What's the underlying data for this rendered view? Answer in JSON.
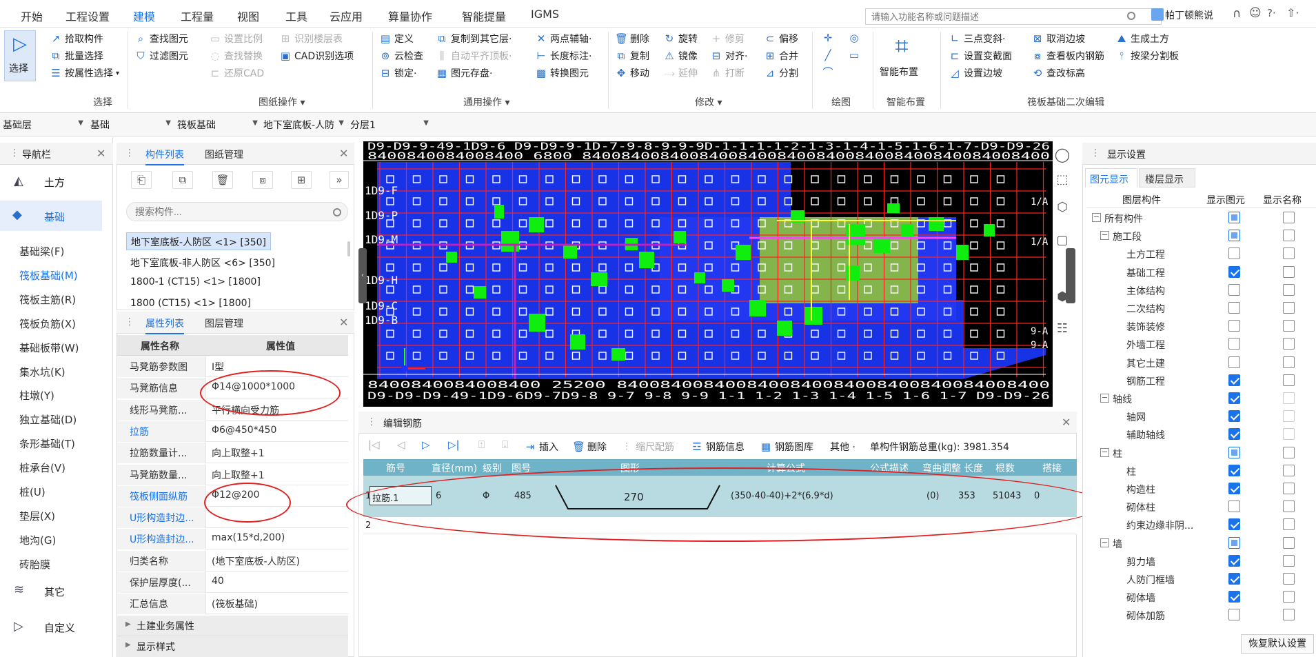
{
  "menu": {
    "items": [
      "开始",
      "工程设置",
      "建模",
      "工程量",
      "视图",
      "工具",
      "云应用",
      "算量协作",
      "智能提量",
      "IGMS"
    ],
    "active_index": 2,
    "search_placeholder": "请输入功能名称或问题描述",
    "user_name": "帕丁顿熊说",
    "help_label": "?·"
  },
  "ribbon": {
    "select": {
      "label": "选择",
      "pick": "拾取构件",
      "batch": "批量选择",
      "by_attr": "按属性选择",
      "group": "选择"
    },
    "drawing": {
      "find": "查找图元",
      "filter": "过滤图元",
      "set_scale": "设置比例",
      "find_replace": "查找替换",
      "restore_cad": "还原CAD",
      "identify_floor": "识别楼层表",
      "cad_options": "CAD识别选项",
      "group": "图纸操作 ▾"
    },
    "common": {
      "define": "定义",
      "cloud_check": "云检查",
      "lock": "锁定·",
      "copy_to_floor": "复制到其它层·",
      "auto_flat": "自动平齐顶板·",
      "save_element": "图元存盘·",
      "two_point_axis": "两点辅轴·",
      "length_mark": "长度标注·",
      "convert": "转换图元",
      "group": "通用操作 ▾"
    },
    "modify": {
      "delete": "删除",
      "rotate": "旋转",
      "trim": "修剪",
      "offset": "偏移",
      "copy": "复制",
      "mirror": "镜像",
      "align": "对齐·",
      "merge": "合并",
      "move": "移动",
      "extend": "延伸",
      "break": "打断",
      "split": "分割",
      "group": "修改 ▾"
    },
    "draw": {
      "group": "绘图"
    },
    "smart": {
      "label": "智能布置",
      "group": "智能布置"
    },
    "raft": {
      "three_point_slope": "三点变斜·",
      "cancel_slope": "取消边坡",
      "gen_earth": "生成土方",
      "set_var_section": "设置变截面",
      "view_rebar": "查看板内钢筋",
      "split_by_beam": "按梁分割板",
      "set_slope": "设置边坡",
      "check_elev": "查改标高",
      "group": "筏板基础二次编辑"
    }
  },
  "floorbar": {
    "floor": "基础层",
    "category": "基础",
    "type": "筏板基础",
    "component": "地下室底板-人防",
    "layer": "分层1"
  },
  "nav": {
    "title": "导航栏",
    "groups": [
      {
        "label": "土方"
      },
      {
        "label": "基础"
      }
    ],
    "items": [
      "基础梁(F)",
      "筏板基础(M)",
      "筏板主筋(R)",
      "筏板负筋(X)",
      "基础板带(W)",
      "集水坑(K)",
      "柱墩(Y)",
      "独立基础(D)",
      "条形基础(T)",
      "桩承台(V)",
      "桩(U)",
      "垫层(X)",
      "地沟(G)",
      "砖胎膜"
    ],
    "selected_index": 1,
    "other": "其它",
    "custom": "自定义"
  },
  "component_list": {
    "tabs": [
      "构件列表",
      "图纸管理"
    ],
    "search_placeholder": "搜索构件...",
    "items": [
      "地下室底板-人防区 <1> [350]",
      "地下室底板-非人防区 <6> [350]",
      "1800-1 (CT15)  <1> [1800]",
      "1800  (CT15)  <1> [1800]"
    ],
    "selected_index": 0
  },
  "properties": {
    "tabs": [
      "属性列表",
      "图层管理"
    ],
    "header_name": "属性名称",
    "header_value": "属性值",
    "rows": [
      {
        "name": "马凳筋参数图",
        "value": "Ⅰ型",
        "blue": false
      },
      {
        "name": "马凳筋信息",
        "value": "Φ14@1000*1000",
        "blue": false
      },
      {
        "name": "线形马凳筋...",
        "value": "平行横向受力筋",
        "blue": false
      },
      {
        "name": "拉筋",
        "value": "Φ6@450*450",
        "blue": true
      },
      {
        "name": "拉筋数量计...",
        "value": "向上取整+1",
        "blue": false
      },
      {
        "name": "马凳筋数量...",
        "value": "向上取整+1",
        "blue": false
      },
      {
        "name": "筏板侧面纵筋",
        "value": "Φ12@200",
        "blue": true
      },
      {
        "name": "U形构造封边...",
        "value": "",
        "blue": true
      },
      {
        "name": "U形构造封边...",
        "value": "max(15*d,200)",
        "blue": true
      },
      {
        "name": "归类名称",
        "value": "(地下室底板-人防区)",
        "blue": false
      },
      {
        "name": "保护层厚度(...",
        "value": "40",
        "blue": false
      },
      {
        "name": "汇总信息",
        "value": "(筏板基础)",
        "blue": false
      }
    ],
    "sections": [
      "土建业务属性",
      "显示样式"
    ]
  },
  "canvas": {
    "top_labels": "D9-D9-9-49-1D9-6  D9-D9-9-1D-7-9-8-9-9-9D-1-1-1-1-2-1-3-1-4-1-5-1-6-1-7-D9-D9-26",
    "top_dims": "8400840084008400 6800 840084008400840084008400840084008400840084008400",
    "bottom_dims": "8400840084008400 25200  8400840084008400840084008400840084008400",
    "bottom_labels": "D9-D9-D9-49-1D9-6D9-7D9-8   9-7 9-8 9-9 1-1 1-2 1-3 1-4 1-5 1-6 1-7 D9-D9-26",
    "row_labels": [
      "1D9-F",
      "1D9-P",
      "1D9-M",
      "1D9-H",
      "1D9-C",
      "1D9-B"
    ],
    "right_labels": [
      "1/A",
      "1/A",
      "9-A",
      "9-A"
    ]
  },
  "rebar": {
    "title": "编辑钢筋",
    "toolbar": {
      "insert": "插入",
      "delete": "删除",
      "scale": "缩尺配筋",
      "info": "钢筋信息",
      "library": "钢筋图库",
      "other": "其他 ·",
      "total": "单构件钢筋总重(kg): 3981.354"
    },
    "columns": [
      "筋号",
      "直径(mm)",
      "级别",
      "图号",
      "图形",
      "计算公式",
      "公式描述",
      "弯曲调整",
      "长度",
      "根数",
      "搭接"
    ],
    "rows": [
      {
        "idx": "1",
        "name": "拉筋.1",
        "dia": "6",
        "grade": "Φ",
        "fig": "485",
        "shape_len": "270",
        "formula": "(350-40-40)+2*(6.9*d)",
        "desc": "",
        "bend": "(0)",
        "length": "353",
        "count": "51043",
        "lap": "0"
      },
      {
        "idx": "2",
        "name": "",
        "dia": "",
        "grade": "",
        "fig": "",
        "shape_len": "",
        "formula": "",
        "desc": "",
        "bend": "",
        "length": "",
        "count": "",
        "lap": ""
      }
    ]
  },
  "display": {
    "title": "显示设置",
    "tabs": [
      "图元显示",
      "楼层显示"
    ],
    "headers": [
      "图层构件",
      "显示图元",
      "显示名称"
    ],
    "rows": [
      {
        "label": "所有构件",
        "level": 0,
        "exp": "−",
        "show": "partial",
        "name": "off"
      },
      {
        "label": "施工段",
        "level": 1,
        "exp": "−",
        "show": "partial",
        "name": "off"
      },
      {
        "label": "土方工程",
        "level": 2,
        "exp": "",
        "show": "off",
        "name": "off"
      },
      {
        "label": "基础工程",
        "level": 2,
        "exp": "",
        "show": "on",
        "name": "off"
      },
      {
        "label": "主体结构",
        "level": 2,
        "exp": "",
        "show": "off",
        "name": "off"
      },
      {
        "label": "二次结构",
        "level": 2,
        "exp": "",
        "show": "off",
        "name": "off"
      },
      {
        "label": "装饰装修",
        "level": 2,
        "exp": "",
        "show": "off",
        "name": "off"
      },
      {
        "label": "外墙工程",
        "level": 2,
        "exp": "",
        "show": "off",
        "name": "off"
      },
      {
        "label": "其它土建",
        "level": 2,
        "exp": "",
        "show": "off",
        "name": "off"
      },
      {
        "label": "钢筋工程",
        "level": 2,
        "exp": "",
        "show": "on",
        "name": "off"
      },
      {
        "label": "轴线",
        "level": 1,
        "exp": "−",
        "show": "on",
        "name": "dim"
      },
      {
        "label": "轴网",
        "level": 2,
        "exp": "",
        "show": "on",
        "name": "dim"
      },
      {
        "label": "辅助轴线",
        "level": 2,
        "exp": "",
        "show": "on",
        "name": "dim"
      },
      {
        "label": "柱",
        "level": 1,
        "exp": "−",
        "show": "partial",
        "name": "off"
      },
      {
        "label": "柱",
        "level": 2,
        "exp": "",
        "show": "on",
        "name": "off"
      },
      {
        "label": "构造柱",
        "level": 2,
        "exp": "",
        "show": "on",
        "name": "off"
      },
      {
        "label": "砌体柱",
        "level": 2,
        "exp": "",
        "show": "off",
        "name": "off"
      },
      {
        "label": "约束边缘非阴...",
        "level": 2,
        "exp": "",
        "show": "on",
        "name": "off"
      },
      {
        "label": "墙",
        "level": 1,
        "exp": "−",
        "show": "partial",
        "name": "off"
      },
      {
        "label": "剪力墙",
        "level": 2,
        "exp": "",
        "show": "on",
        "name": "off"
      },
      {
        "label": "人防门框墙",
        "level": 2,
        "exp": "",
        "show": "on",
        "name": "off"
      },
      {
        "label": "砌体墙",
        "level": 2,
        "exp": "",
        "show": "on",
        "name": "off"
      },
      {
        "label": "砌体加筋",
        "level": 2,
        "exp": "",
        "show": "off",
        "name": "off"
      }
    ],
    "restore": "恢复默认设置"
  }
}
